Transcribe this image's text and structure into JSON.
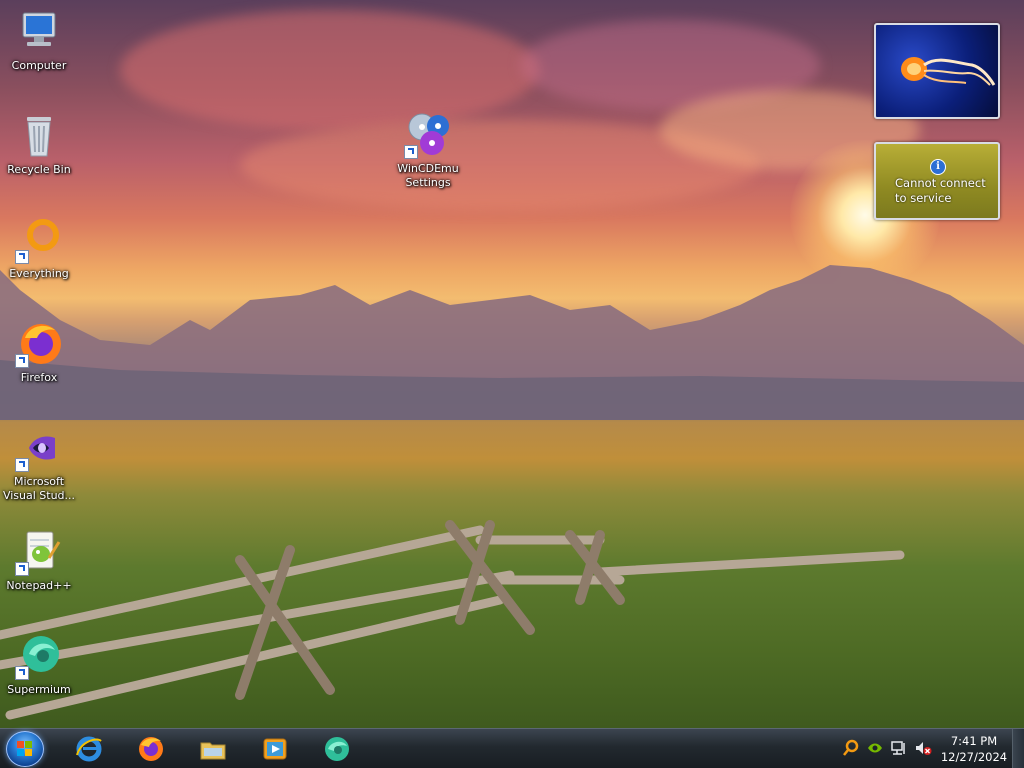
{
  "desktop": {
    "icons": [
      {
        "label": "Computer"
      },
      {
        "label": "Recycle Bin"
      },
      {
        "label": "Everything"
      },
      {
        "label": "Firefox"
      },
      {
        "label": "Microsoft Visual Stud..."
      },
      {
        "label": "Notepad++"
      },
      {
        "label": "Supermium"
      },
      {
        "label": "WinCDEmu Settings"
      }
    ]
  },
  "gadgets": {
    "weather": {
      "message_line1": "Cannot connect",
      "message_line2": "to service",
      "info_glyph": "i"
    }
  },
  "taskbar": {
    "pinned": [
      {
        "icon": "internet-explorer-icon"
      },
      {
        "icon": "firefox-icon"
      },
      {
        "icon": "file-explorer-icon"
      },
      {
        "icon": "media-player-icon"
      },
      {
        "icon": "supermium-icon"
      }
    ],
    "tray": {
      "time": "7:41 PM",
      "date": "12/27/2024"
    }
  },
  "colors": {
    "taskbar": "#1e252b",
    "accent": "#2b7cd3",
    "weather_gadget": "#a59d2e"
  }
}
